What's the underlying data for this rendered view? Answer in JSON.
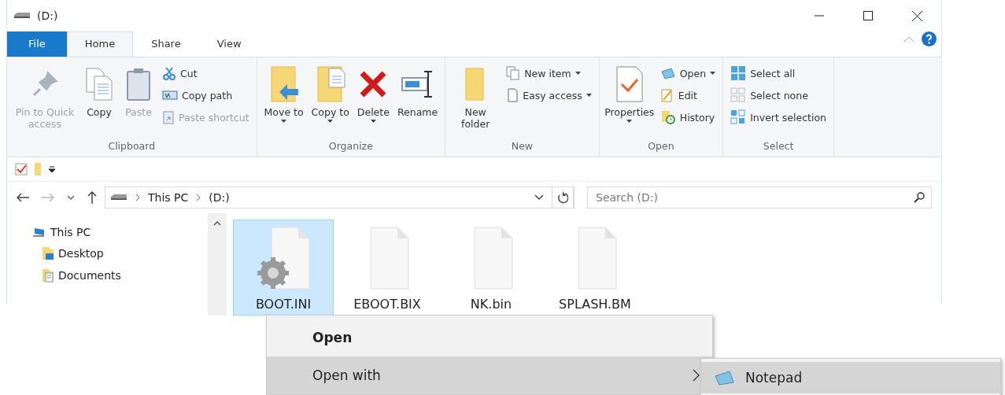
{
  "window": {
    "title": "(D:)"
  },
  "tabs": [
    {
      "label": "File",
      "kind": "file",
      "selected": false
    },
    {
      "label": "Home",
      "kind": "tab",
      "selected": true
    },
    {
      "label": "Share",
      "kind": "tab",
      "selected": false
    },
    {
      "label": "View",
      "kind": "tab",
      "selected": false
    }
  ],
  "ribbon": {
    "groups": [
      {
        "name": "Clipboard",
        "large": [
          {
            "label": "Pin to Quick access",
            "kind": "pin",
            "disabled": true,
            "has_menu": false
          },
          {
            "label": "Copy",
            "kind": "copy",
            "disabled": false,
            "has_menu": false
          },
          {
            "label": "Paste",
            "kind": "paste",
            "disabled": true,
            "has_menu": false
          }
        ],
        "small": [
          {
            "label": "Cut",
            "kind": "cut",
            "disabled": false,
            "has_menu": false
          },
          {
            "label": "Copy path",
            "kind": "copy-path",
            "disabled": false,
            "has_menu": false
          },
          {
            "label": "Paste shortcut",
            "kind": "paste-shortcut",
            "disabled": true,
            "has_menu": false
          }
        ]
      },
      {
        "name": "Organize",
        "large": [
          {
            "label": "Move to",
            "kind": "move",
            "disabled": false,
            "has_menu": true
          },
          {
            "label": "Copy to",
            "kind": "copy-to",
            "disabled": false,
            "has_menu": true
          },
          {
            "label": "Delete",
            "kind": "delete",
            "disabled": false,
            "has_menu": true
          },
          {
            "label": "Rename",
            "kind": "rename",
            "disabled": false,
            "has_menu": false
          }
        ]
      },
      {
        "name": "New",
        "large": [
          {
            "label": "New folder",
            "kind": "new-folder",
            "disabled": false,
            "has_menu": false
          }
        ],
        "small": [
          {
            "label": "New item",
            "kind": "new-item",
            "disabled": false,
            "has_menu": true
          },
          {
            "label": "Easy access",
            "kind": "easy-access",
            "disabled": false,
            "has_menu": true
          }
        ]
      },
      {
        "name": "Open",
        "large": [
          {
            "label": "Properties",
            "kind": "properties",
            "disabled": false,
            "has_menu": true
          }
        ],
        "small": [
          {
            "label": "Open",
            "kind": "open",
            "disabled": false,
            "has_menu": true
          },
          {
            "label": "Edit",
            "kind": "edit",
            "disabled": false,
            "has_menu": false
          },
          {
            "label": "History",
            "kind": "history",
            "disabled": false,
            "has_menu": false
          }
        ]
      },
      {
        "name": "Select",
        "small": [
          {
            "label": "Select all",
            "kind": "select-all",
            "disabled": false,
            "has_menu": false
          },
          {
            "label": "Select none",
            "kind": "select-none",
            "disabled": false,
            "has_menu": false
          },
          {
            "label": "Invert selection",
            "kind": "invert",
            "disabled": false,
            "has_menu": false
          }
        ]
      }
    ]
  },
  "address": {
    "crumbs": [
      "This PC",
      "(D:)"
    ],
    "search_placeholder": "Search (D:)"
  },
  "nav": [
    {
      "label": "This PC",
      "kind": "pc",
      "children": [
        {
          "label": "Desktop",
          "kind": "desktop"
        },
        {
          "label": "Documents",
          "kind": "documents"
        }
      ]
    }
  ],
  "files": [
    {
      "name": "BOOT.INI",
      "kind": "settings",
      "selected": true
    },
    {
      "name": "EBOOT.BIX",
      "kind": "blank",
      "selected": false
    },
    {
      "name": "NK.bin",
      "kind": "blank",
      "selected": false
    },
    {
      "name": "SPLASH.BM",
      "kind": "blank",
      "selected": false
    }
  ],
  "context_menu": [
    {
      "label": "Open",
      "default": true,
      "selected": false,
      "has_submenu": false
    },
    {
      "label": "Open with",
      "default": false,
      "selected": true,
      "has_submenu": true
    }
  ],
  "submenu": [
    {
      "label": "Notepad",
      "selected": true
    }
  ]
}
